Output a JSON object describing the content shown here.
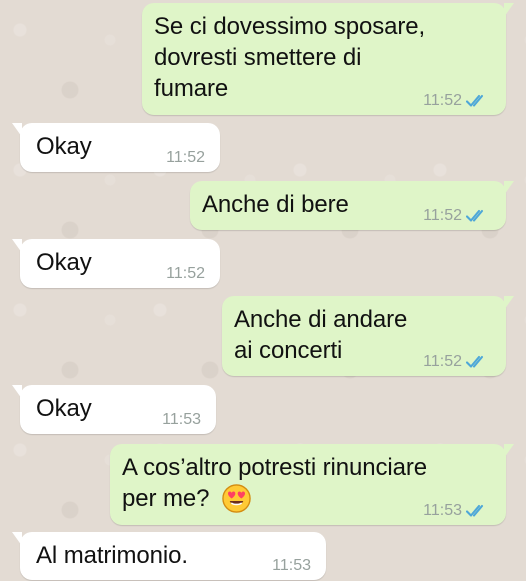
{
  "messages": [
    {
      "direction": "outgoing",
      "text": "Se ci dovessimo sposare,\ndovresti smettere di\nfumare",
      "time": "11:52",
      "status_icon": "double-check-icon"
    },
    {
      "direction": "incoming",
      "text": "Okay",
      "time": "11:52"
    },
    {
      "direction": "outgoing",
      "text": "Anche di bere",
      "time": "11:52",
      "status_icon": "double-check-icon"
    },
    {
      "direction": "incoming",
      "text": "Okay",
      "time": "11:52"
    },
    {
      "direction": "outgoing",
      "text": "Anche di andare\nai concerti",
      "time": "11:52",
      "status_icon": "double-check-icon"
    },
    {
      "direction": "incoming",
      "text": "Okay",
      "time": "11:53"
    },
    {
      "direction": "outgoing",
      "text": "A cos’altro potresti rinunciare\nper me?",
      "time": "11:53",
      "status_icon": "double-check-icon",
      "emoji": "heart-eyes-emoji"
    },
    {
      "direction": "incoming",
      "text": "Al matrimonio.",
      "time": "11:53"
    }
  ],
  "theme": {
    "background": "#e3dbd3",
    "outgoing_bubble": "#dff5c8",
    "incoming_bubble": "#ffffff",
    "timestamp": "#97a19d",
    "read_ticks": "#4ea7d8"
  }
}
